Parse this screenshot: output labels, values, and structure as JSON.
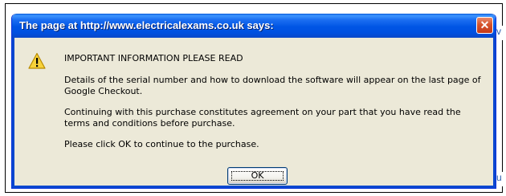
{
  "background": {
    "scrap_top": "v",
    "scrap_bottom": "u"
  },
  "dialog": {
    "title": "The page at http://www.electricalexams.co.uk says:",
    "close_glyph": "✕",
    "icon": "warning-icon",
    "messages": [
      "IMPORTANT INFORMATION PLEASE READ",
      "Details of the serial number and how to download the software will appear on the last page of Google Checkout.",
      "Continuing with this purchase constitutes agreement on your part that you have read the terms and conditions before purchase.",
      "Please click OK to continue to the purchase."
    ],
    "ok_label": "OK"
  }
}
